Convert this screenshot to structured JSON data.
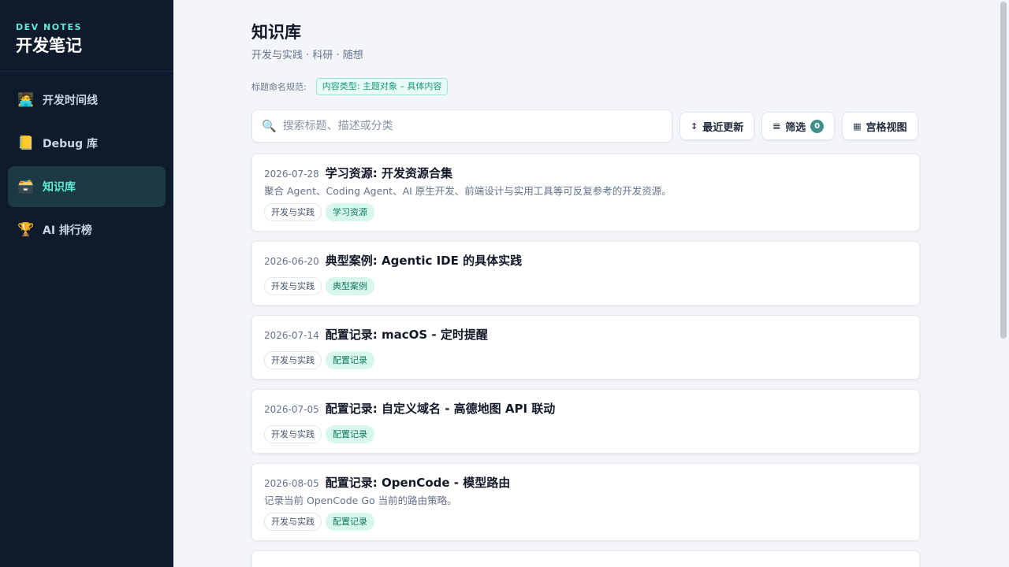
{
  "sidebar": {
    "brand_sub": "DEV NOTES",
    "brand_title": "开发笔记",
    "items": [
      {
        "label": "开发时间线",
        "icon": "🧑‍💻",
        "active": false
      },
      {
        "label": "Debug 库",
        "icon": "📒",
        "active": false
      },
      {
        "label": "知识库",
        "icon": "🗃️",
        "active": true
      },
      {
        "label": "AI 排行榜",
        "icon": "🏆",
        "active": false
      }
    ]
  },
  "header": {
    "title": "知识库",
    "subtitle": "开发与实践 · 科研 · 随想",
    "naming_label": "标题命名规范:",
    "naming_rule": "内容类型: 主题对象 – 具体内容"
  },
  "toolbar": {
    "search_placeholder": "搜索标题、描述或分类",
    "sort_label": "最近更新",
    "sort_icon": "↕",
    "filter_label": "筛选",
    "filter_icon": "𝌆",
    "filter_count": "0",
    "grid_label": "宫格视图",
    "grid_icon": "▦"
  },
  "colors": {
    "sidebar_bg": "#0f1b2d",
    "accent": "#5eead4",
    "tag_type_bg": "#d7f7ec",
    "tag_type_text": "#11795f"
  },
  "cards": [
    {
      "date": "2026-07-28",
      "title": "学习资源: 开发资源合集",
      "desc": "聚合 Agent、Coding Agent、AI 原生开发、前端设计与实用工具等可反复参考的开发资源。",
      "tags": [
        "开发与实践",
        "学习资源"
      ]
    },
    {
      "date": "2026-06-20",
      "title": "典型案例: Agentic IDE 的具体实践",
      "desc": "",
      "tags": [
        "开发与实践",
        "典型案例"
      ]
    },
    {
      "date": "2026-07-14",
      "title": "配置记录: macOS - 定时提醒",
      "desc": "",
      "tags": [
        "开发与实践",
        "配置记录"
      ]
    },
    {
      "date": "2026-07-05",
      "title": "配置记录: 自定义域名 - 高德地图 API 联动",
      "desc": "",
      "tags": [
        "开发与实践",
        "配置记录"
      ]
    },
    {
      "date": "2026-08-05",
      "title": "配置记录: OpenCode - 模型路由",
      "desc": "记录当前 OpenCode Go 当前的路由策略。",
      "tags": [
        "开发与实践",
        "配置记录"
      ]
    }
  ]
}
